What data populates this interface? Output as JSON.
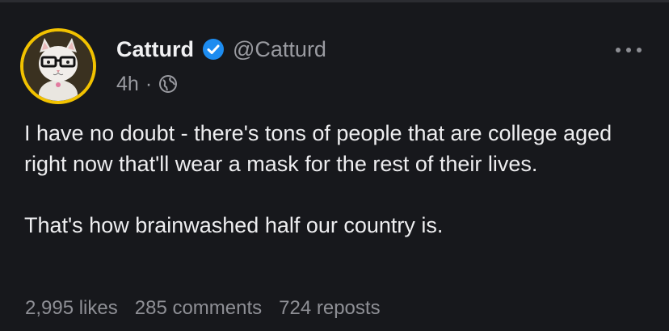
{
  "post": {
    "author": {
      "display_name": "Catturd",
      "handle": "@Catturd",
      "verified": true,
      "avatar_icon": "cat-with-glasses-avatar"
    },
    "timestamp": "4h",
    "separator": "·",
    "visibility_icon": "globe-icon",
    "body": {
      "paragraph_1": "I have no doubt - there's tons of people that are college aged right now that'll wear a mask for the rest of their lives.",
      "paragraph_2": "That's how brainwashed half our country is."
    },
    "stats": {
      "likes": "2,995 likes",
      "comments": "285 comments",
      "reposts": "724 reposts"
    }
  },
  "colors": {
    "background": "#17181c",
    "avatar_ring": "#f2c200",
    "verified_badge": "#1d8cf0",
    "primary_text": "#eeeef0",
    "secondary_text": "#9a9ba1"
  }
}
